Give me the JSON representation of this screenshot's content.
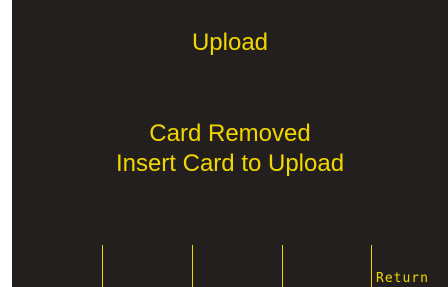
{
  "screen": {
    "title": "Upload",
    "message_line_1": "Card Removed",
    "message_line_2": "Insert Card to Upload"
  },
  "softkeys": [
    {
      "label": ""
    },
    {
      "label": ""
    },
    {
      "label": ""
    },
    {
      "label": ""
    },
    {
      "label": "Return"
    }
  ],
  "colors": {
    "background": "#231f1f",
    "text": "#f2d600"
  }
}
